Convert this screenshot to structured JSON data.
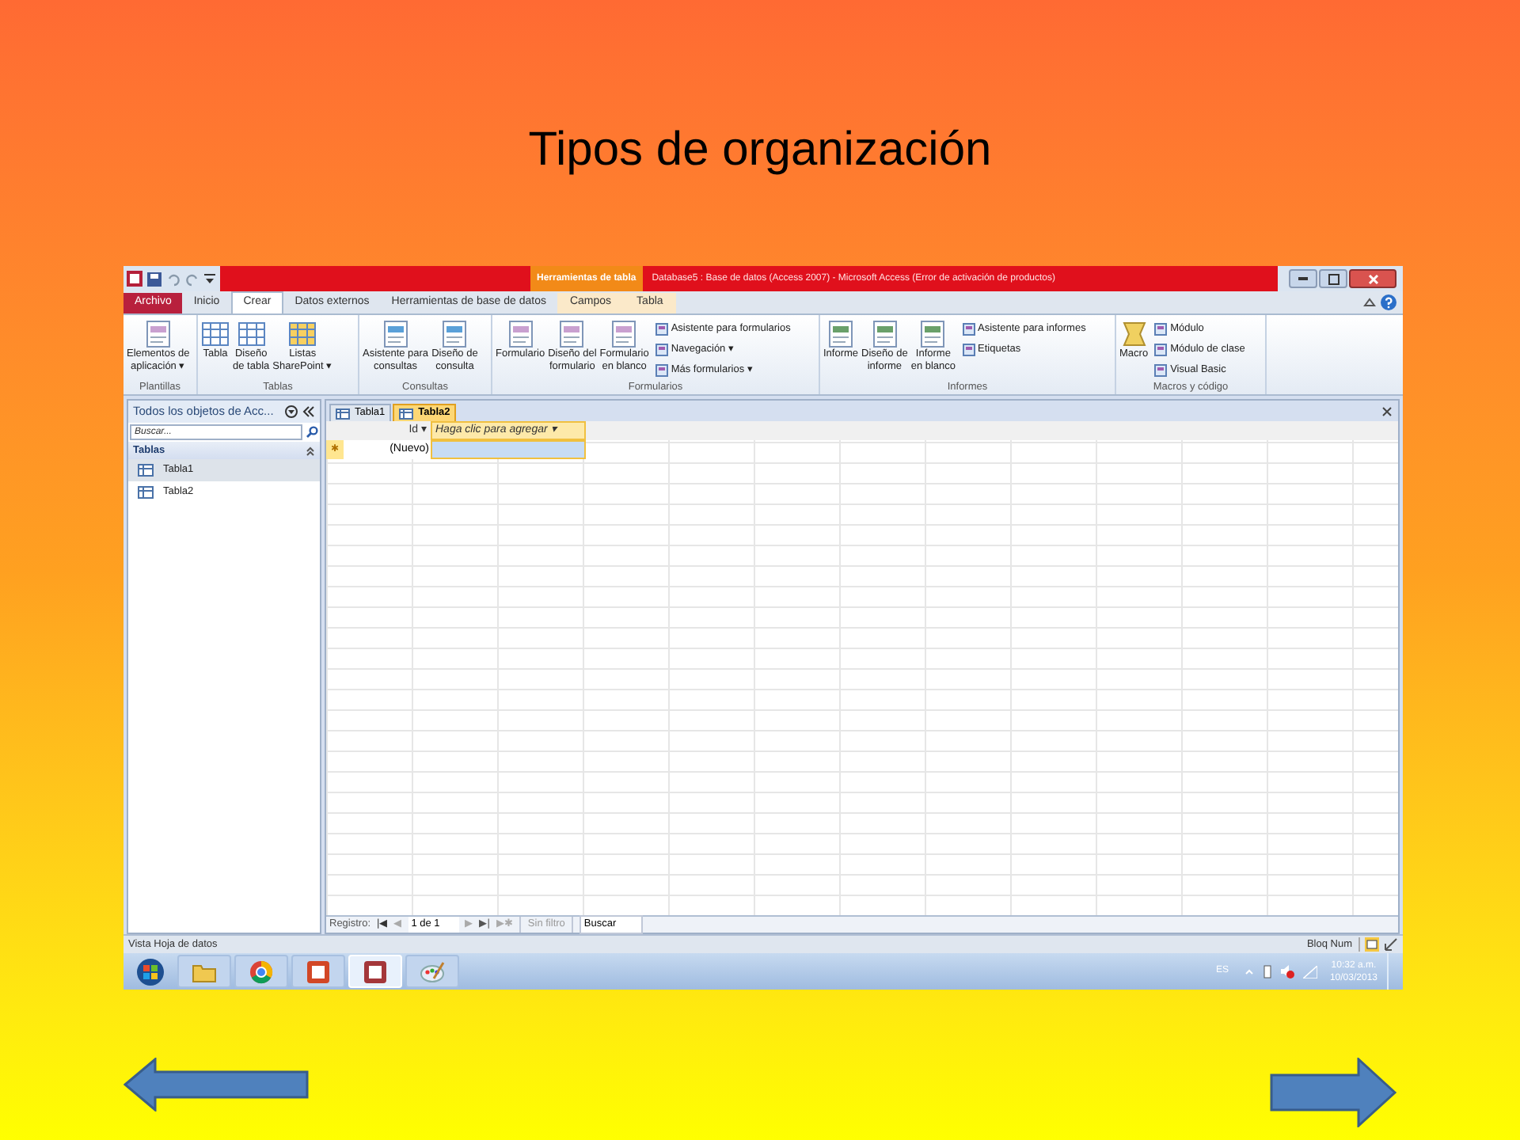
{
  "slide": {
    "title": "Tipos de organización"
  },
  "window": {
    "context_group": "Herramientas de tabla",
    "title": "Database5 : Base de datos (Access 2007)  -  Microsoft Access (Error de activación de productos)"
  },
  "ribbon_tabs": [
    {
      "label": "Archivo",
      "kind": "file",
      "selected": false
    },
    {
      "label": "Inicio",
      "kind": "tab",
      "selected": false
    },
    {
      "label": "Crear",
      "kind": "tab",
      "selected": true
    },
    {
      "label": "Datos externos",
      "kind": "tab",
      "selected": false
    },
    {
      "label": "Herramientas de base de datos",
      "kind": "tab",
      "selected": false
    },
    {
      "label": "Campos",
      "kind": "context",
      "selected": false
    },
    {
      "label": "Tabla",
      "kind": "context",
      "selected": false
    }
  ],
  "ribbon_groups": [
    {
      "label": "Plantillas",
      "commands": [
        {
          "kind": "large",
          "label": "Elementos de\naplicación ▾"
        }
      ]
    },
    {
      "label": "Tablas",
      "commands": [
        {
          "kind": "large",
          "label": "Tabla"
        },
        {
          "kind": "large",
          "label": "Diseño\nde tabla"
        },
        {
          "kind": "large",
          "label": "Listas\nSharePoint ▾"
        }
      ]
    },
    {
      "label": "Consultas",
      "commands": [
        {
          "kind": "large",
          "label": "Asistente para\nconsultas"
        },
        {
          "kind": "large",
          "label": "Diseño de\nconsulta"
        }
      ]
    },
    {
      "label": "Formularios",
      "commands": [
        {
          "kind": "large",
          "label": "Formulario"
        },
        {
          "kind": "large",
          "label": "Diseño del\nformulario"
        },
        {
          "kind": "large",
          "label": "Formulario\nen blanco"
        },
        {
          "kind": "small",
          "label": "Asistente para formularios"
        },
        {
          "kind": "small",
          "label": "Navegación ▾"
        },
        {
          "kind": "small",
          "label": "Más formularios ▾"
        }
      ]
    },
    {
      "label": "Informes",
      "commands": [
        {
          "kind": "large",
          "label": "Informe"
        },
        {
          "kind": "large",
          "label": "Diseño de\ninforme"
        },
        {
          "kind": "large",
          "label": "Informe\nen blanco"
        },
        {
          "kind": "small",
          "label": "Asistente para informes"
        },
        {
          "kind": "small",
          "label": "Etiquetas"
        }
      ]
    },
    {
      "label": "Macros y código",
      "commands": [
        {
          "kind": "large",
          "label": "Macro"
        },
        {
          "kind": "small",
          "label": "Módulo"
        },
        {
          "kind": "small",
          "label": "Módulo de clase"
        },
        {
          "kind": "small",
          "label": "Visual Basic"
        }
      ]
    }
  ],
  "navigation_pane": {
    "title": "Todos los objetos de Acc...",
    "search_placeholder": "Buscar...",
    "group": "Tablas",
    "items": [
      {
        "label": "Tabla1",
        "selected": true
      },
      {
        "label": "Tabla2",
        "selected": false
      }
    ]
  },
  "document_tabs": [
    {
      "label": "Tabla1",
      "selected": false
    },
    {
      "label": "Tabla2",
      "selected": true
    }
  ],
  "datasheet": {
    "columns": [
      {
        "label": "Id ▾",
        "kind": "field"
      },
      {
        "label": "Haga clic para agregar ▾",
        "kind": "add"
      }
    ],
    "new_row_marker": "✱",
    "new_row": "(Nuevo)"
  },
  "record_navigator": {
    "label": "Registro:",
    "first": "|◀",
    "previous": "◀",
    "position": "1 de 1",
    "next": "▶",
    "last": "▶|",
    "new": "▶✱",
    "filter": "Sin filtro",
    "search": "Buscar"
  },
  "status_bar": {
    "view": "Vista Hoja de datos",
    "num_lock": "Bloq Num"
  },
  "taskbar": {
    "apps": [
      {
        "selected": false
      },
      {
        "selected": false
      },
      {
        "selected": false
      },
      {
        "selected": true
      },
      {
        "selected": false
      }
    ],
    "language": "ES",
    "time": "10:32 a.m.",
    "date": "10/03/2013"
  }
}
